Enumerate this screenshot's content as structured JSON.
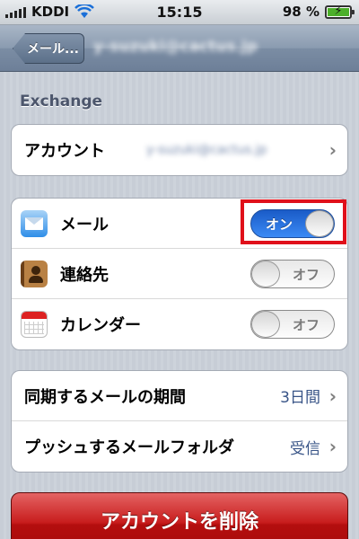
{
  "status_bar": {
    "carrier": "KDDI",
    "time": "15:15",
    "battery_percent": "98 %",
    "battery_level": 0.98
  },
  "nav": {
    "back_label": "メール...",
    "title": "y-suzuki@cactus.jp"
  },
  "exchange": {
    "header": "Exchange",
    "account_label": "アカウント",
    "account_value": "y-suzuki@cactus.jp"
  },
  "sync": {
    "mail_label": "メール",
    "mail_toggle": "オン",
    "contacts_label": "連絡先",
    "contacts_toggle": "オフ",
    "calendar_label": "カレンダー",
    "calendar_toggle": "オフ"
  },
  "settings": {
    "period_label": "同期するメールの期間",
    "period_value": "3日間",
    "push_label": "プッシュするメールフォルダ",
    "push_value": "受信"
  },
  "delete_label": "アカウントを削除",
  "colors": {
    "accent_blue": "#385487",
    "toggle_on": "#2f7de8",
    "highlight": "#e0101a",
    "delete_red": "#c81d1d"
  }
}
